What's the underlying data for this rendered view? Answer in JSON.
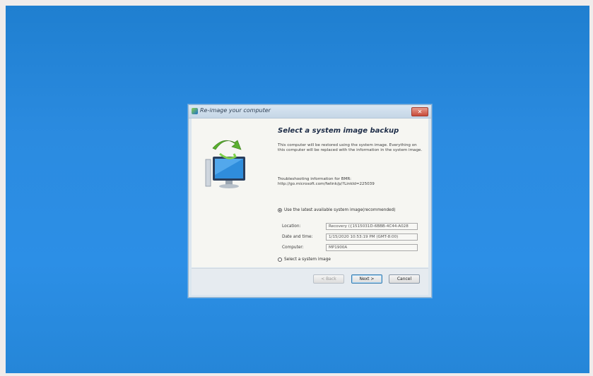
{
  "window": {
    "title": "Re-image your computer",
    "close_label": "✕"
  },
  "main": {
    "heading": "Select a system image backup",
    "description": "This computer will be restored using the system image. Everything on this computer will be replaced with the information in the system image.",
    "troubleshoot_line1": "Troubleshooting information for BMR:",
    "troubleshoot_line2": "http://go.microsoft.com/fwlink/p/?LinkId=225039",
    "option_latest": "Use the latest available system image(recommended)",
    "option_select": "Select a system image",
    "fields": [
      {
        "label": "Location:",
        "value": "Recovery ({1515031D-6BBB-4C44-A028"
      },
      {
        "label": "Date and time:",
        "value": "1/15/2020 10:53:19 PM (GMT-8:00)"
      },
      {
        "label": "Computer:",
        "value": "MP1900A"
      }
    ]
  },
  "buttons": {
    "back": "< Back",
    "next": "Next >",
    "cancel": "Cancel"
  },
  "icons": {
    "window": "restore-icon",
    "art": "computer-restore-icon"
  },
  "colors": {
    "desktop": "#2b8be0",
    "close": "#c74b3a"
  }
}
